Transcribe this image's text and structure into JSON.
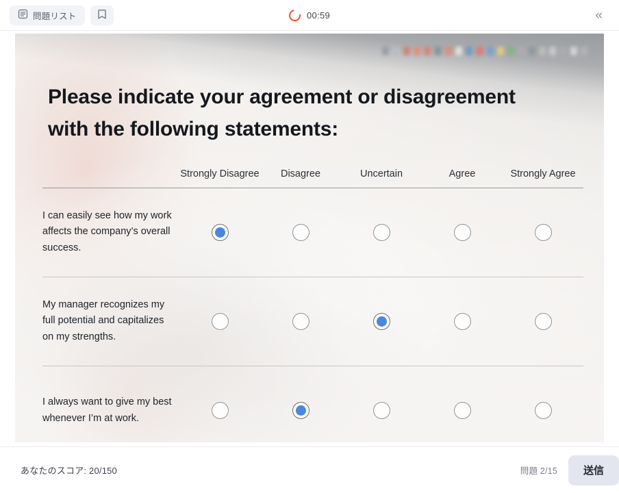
{
  "topbar": {
    "question_list_label": "問題リスト",
    "question_list_icon": "list-document-icon",
    "bookmark_icon": "bookmark-icon",
    "timer": "00:59",
    "timer_icon": "timer-ring-icon",
    "collapse_icon": "double-chevron-left-icon",
    "timer_color": "#f04a23"
  },
  "slide": {
    "title": "Please indicate your agreement or disagreement with the following statements:",
    "background_description": "blurred photo of hands typing on a white keyboard at a desk with a monitor"
  },
  "matrix": {
    "columns": [
      "Strongly Disagree",
      "Disagree",
      "Uncertain",
      "Agree",
      "Strongly Agree"
    ],
    "rows": [
      {
        "statement": "I can easily see how my work affects the company’s overall success.",
        "selected": 0
      },
      {
        "statement": "My manager recognizes my full potential and capitalizes on my strengths.",
        "selected": 2
      },
      {
        "statement": "I always want to give my best whenever I’m at work.",
        "selected": 1
      }
    ],
    "selected_color": "#4a87de"
  },
  "bottombar": {
    "score_label": "あなたのスコア: 20/150",
    "progress_label": "問題 2/15",
    "submit_label": "送信"
  },
  "dock_icon_colors": [
    "#6b7280",
    "#9ca3af",
    "#c0492f",
    "#e05a3a",
    "#cc4b33",
    "#5b6470",
    "#d95f3d",
    "#e8e2da",
    "#2f6fb5",
    "#d8413a",
    "#3a7fc4",
    "#e0c24a",
    "#4f9a52",
    "#8e8e8e",
    "#5f6b75",
    "#a8a8a8",
    "#bdbdbd",
    "#8a8f95",
    "#cfcfcf",
    "#9a9a9a"
  ]
}
